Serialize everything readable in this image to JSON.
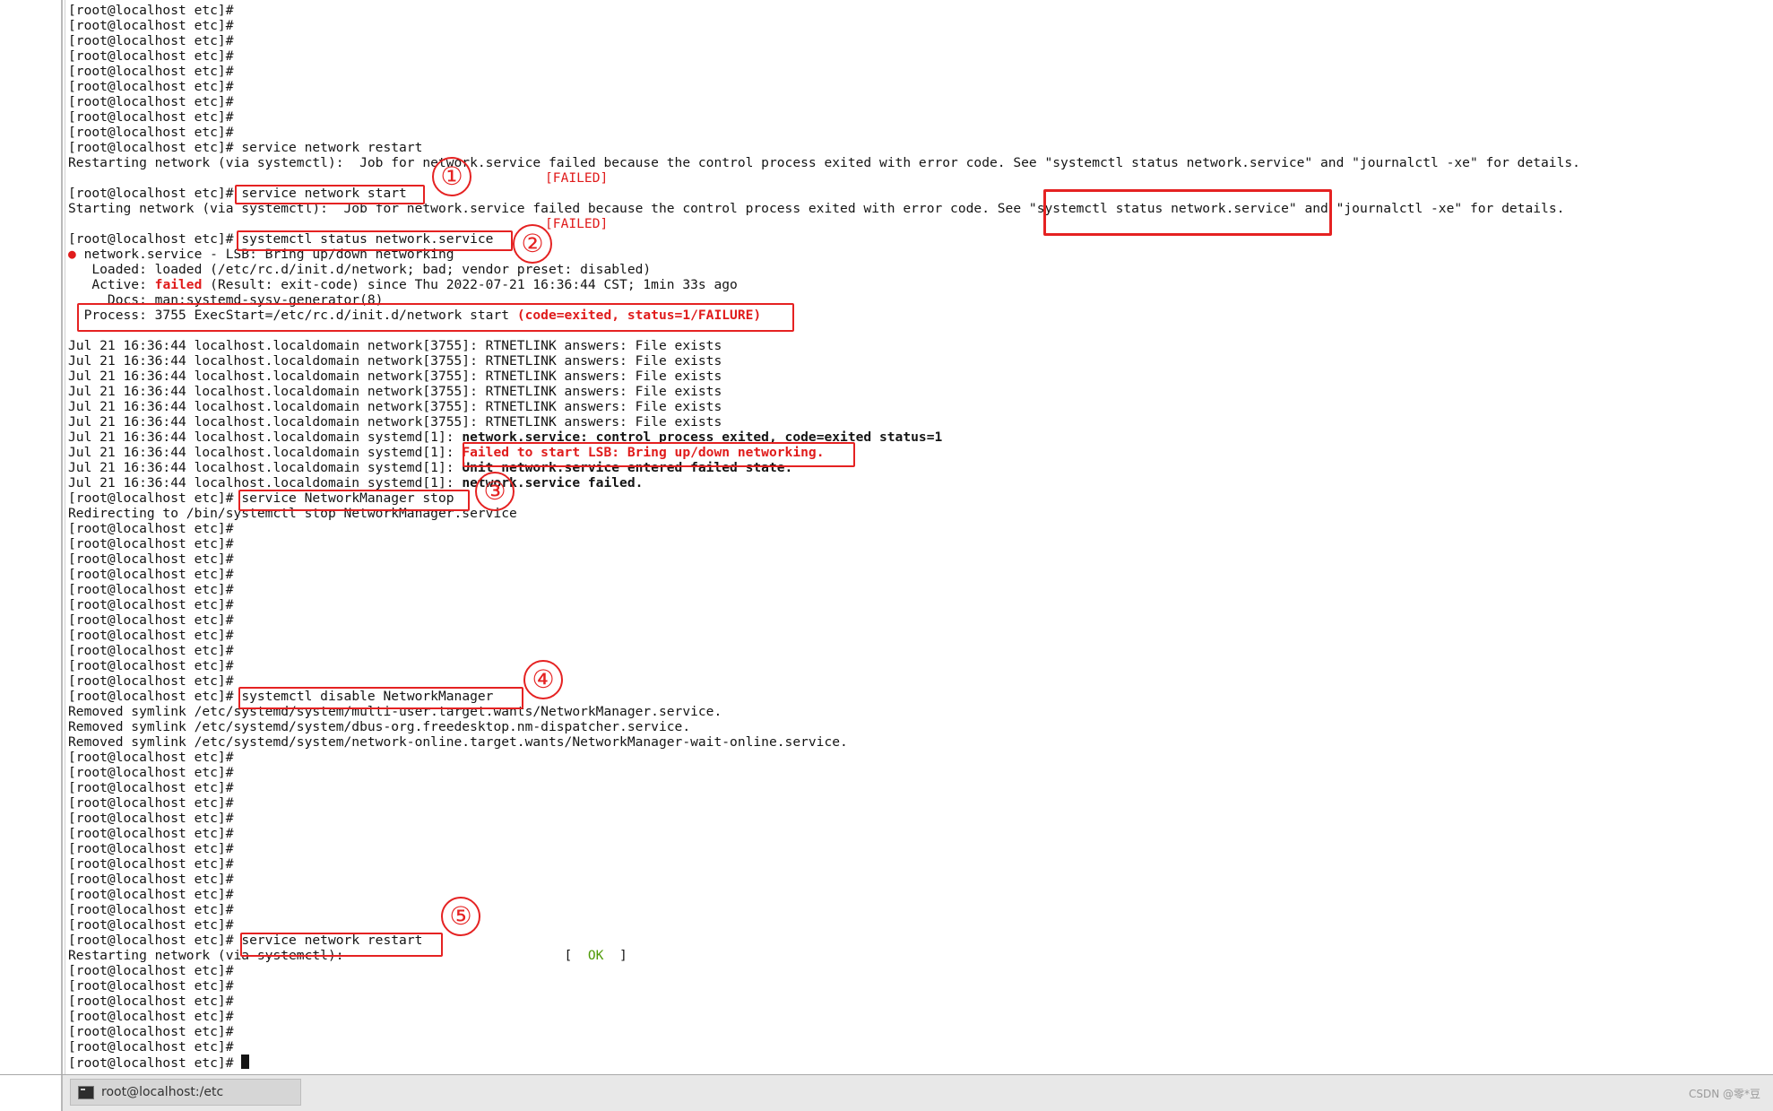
{
  "prompt": "[root@localhost etc]#",
  "terminal": {
    "cmd_network_restart": "service network restart",
    "restart_msg": "Restarting network (via systemctl):  Job for network.service failed because the control process exited with error code. See \"systemctl status network.service\" and \"journalctl -xe\" for details.",
    "failed_tag": "[FAILED]",
    "cmd_network_start": "service network start",
    "start_msg_a": "Starting network (via systemctl):  Job for network.service failed because the control process exited with error code. See ",
    "start_msg_b": "\"systemctl status network.service\"",
    "start_msg_c": " and \"journalctl -xe\" for details.",
    "cmd_status": "systemctl status network.service",
    "status_bullet": "●",
    "status_title": " network.service - LSB: Bring up/down networking",
    "status_loaded": "   Loaded: loaded (/etc/rc.d/init.d/network; bad; vendor preset: disabled)",
    "status_active_label": "   Active: ",
    "status_active_value": "failed",
    "status_active_rest": " (Result: exit-code) since Thu 2022-07-21 16:36:44 CST; 1min 33s ago",
    "status_docs": "     Docs: man:systemd-sysv-generator(8)",
    "status_process_a": "  Process: 3755 ExecStart=/etc/rc.d/init.d/network start ",
    "status_process_b": "(code=exited, status=1/FAILURE)",
    "log_rtnetlink": "Jul 21 16:36:44 localhost.localdomain network[3755]: RTNETLINK answers: File exists",
    "log_prefix_systemd": "Jul 21 16:36:44 localhost.localdomain systemd[1]: ",
    "log_control": "network.service: control process exited, code=exited status=1",
    "log_failed_start": "Failed to start LSB: Bring up/down networking.",
    "log_unit_failed": "Unit network.service entered failed state.",
    "log_service_failed": "network.service failed.",
    "cmd_nm_stop": "service NetworkManager stop",
    "nm_redirect": "Redirecting to /bin/systemctl stop NetworkManager.service",
    "cmd_nm_disable": "systemctl disable NetworkManager",
    "symlink_1": "Removed symlink /etc/systemd/system/multi-user.target.wants/NetworkManager.service.",
    "symlink_2": "Removed symlink /etc/systemd/system/dbus-org.freedesktop.nm-dispatcher.service.",
    "symlink_3": "Removed symlink /etc/systemd/system/network-online.target.wants/NetworkManager-wait-online.service.",
    "cmd_final_restart": "service network restart",
    "final_restart_msg": "Restarting network (via systemctl):                            [  ",
    "ok_label": "OK",
    "ok_close": "  ]"
  },
  "annotations": [
    "①",
    "②",
    "③",
    "④",
    "⑤"
  ],
  "taskbar": {
    "window_label": "root@localhost:/etc"
  },
  "watermark": "CSDN @零*豆",
  "colors": {
    "annotation_red": "#e52222",
    "error_red": "#e01b1b",
    "ok_green": "#4e9a06",
    "text": "#141414"
  }
}
